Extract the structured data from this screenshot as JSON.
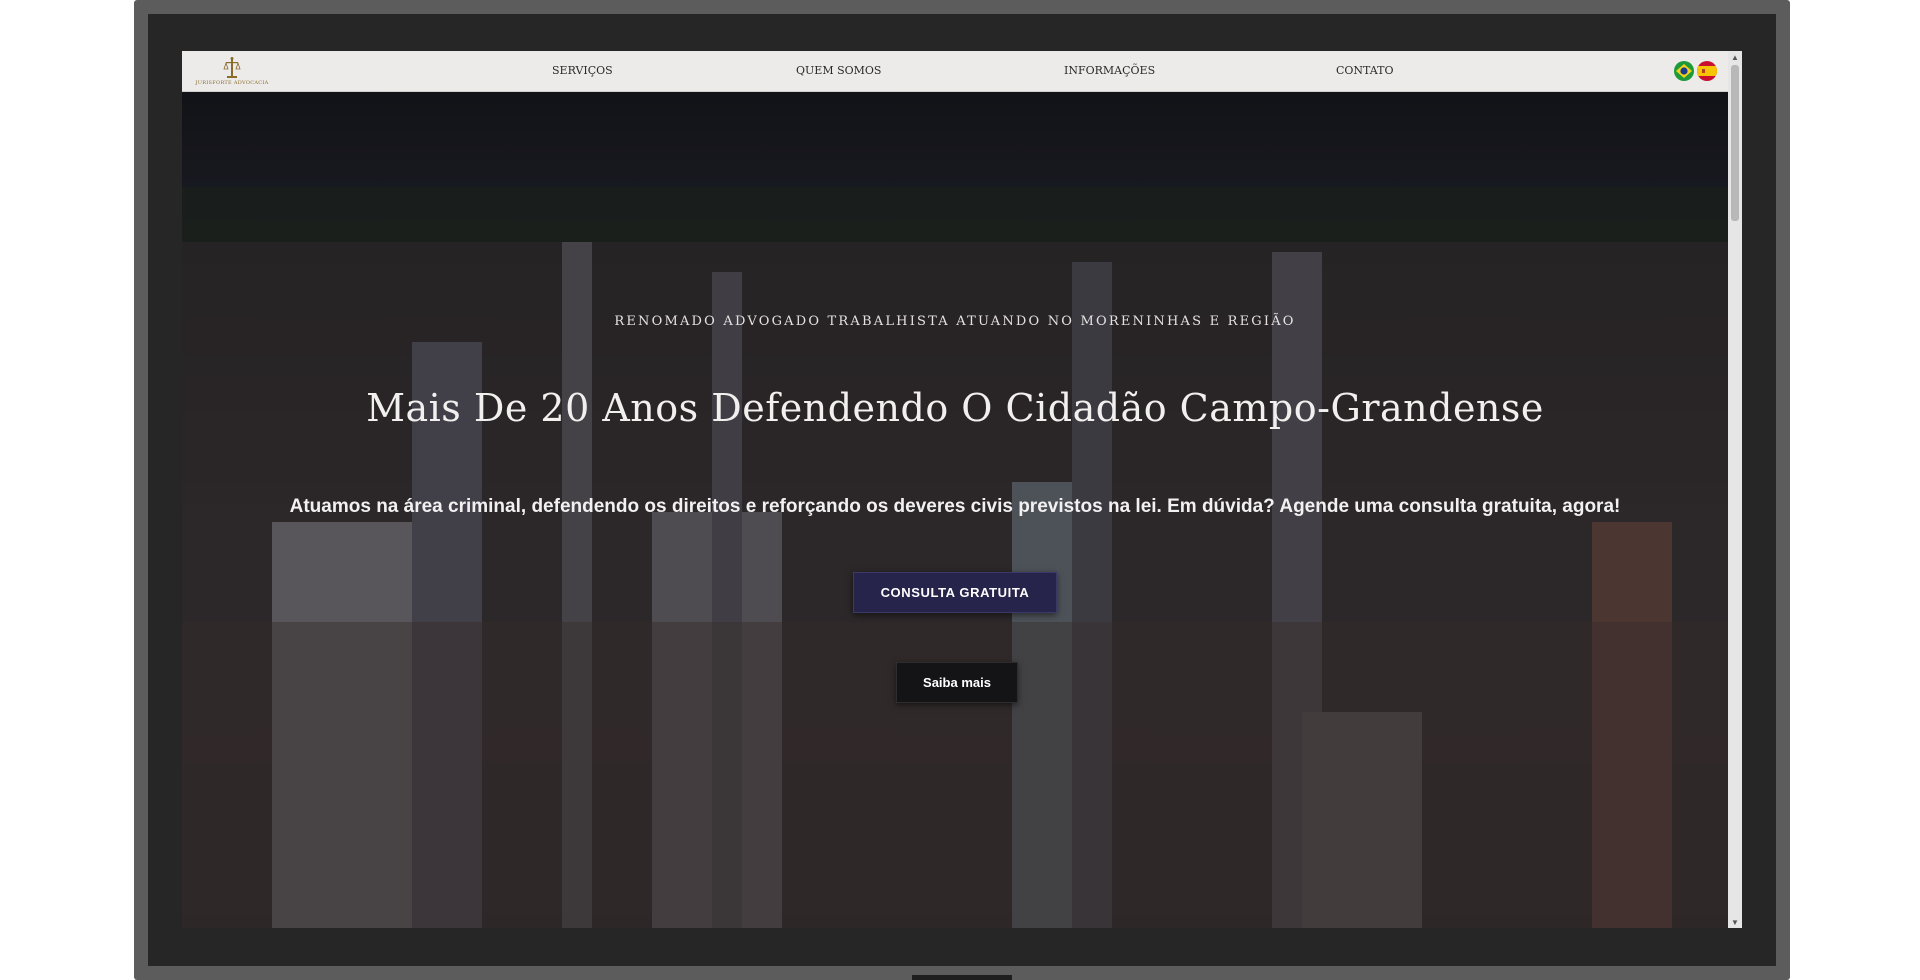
{
  "brand": {
    "logo_text": "JURISFORTE ADVOCACIA"
  },
  "nav": {
    "items": [
      {
        "label": "SERVIÇOS"
      },
      {
        "label": "QUEM SOMOS"
      },
      {
        "label": "INFORMAÇÕES"
      },
      {
        "label": "CONTATO"
      }
    ],
    "languages": [
      {
        "icon": "brazil-flag-icon",
        "colors": [
          "#1f9a3a",
          "#f4d21b",
          "#1a3c8f"
        ]
      },
      {
        "icon": "spain-flag-icon",
        "colors": [
          "#c8102e",
          "#f6c400"
        ]
      }
    ]
  },
  "hero": {
    "eyebrow": "RENOMADO ADVOGADO TRABALHISTA ATUANDO NO MORENINHAS E REGIÃO",
    "headline": "Mais De 20 Anos Defendendo O Cidadão Campo-Grandense",
    "subline": "Atuamos na área criminal, defendendo os direitos e reforçando os deveres civis previstos na lei. Em dúvida? Agende uma consulta gratuita, agora!",
    "primary_button": "CONSULTA GRATUITA",
    "secondary_button": "Saiba mais"
  },
  "colors": {
    "primary_button_bg": "#26244a",
    "secondary_button_bg": "#141416",
    "navbar_bg": "#ecebea"
  }
}
